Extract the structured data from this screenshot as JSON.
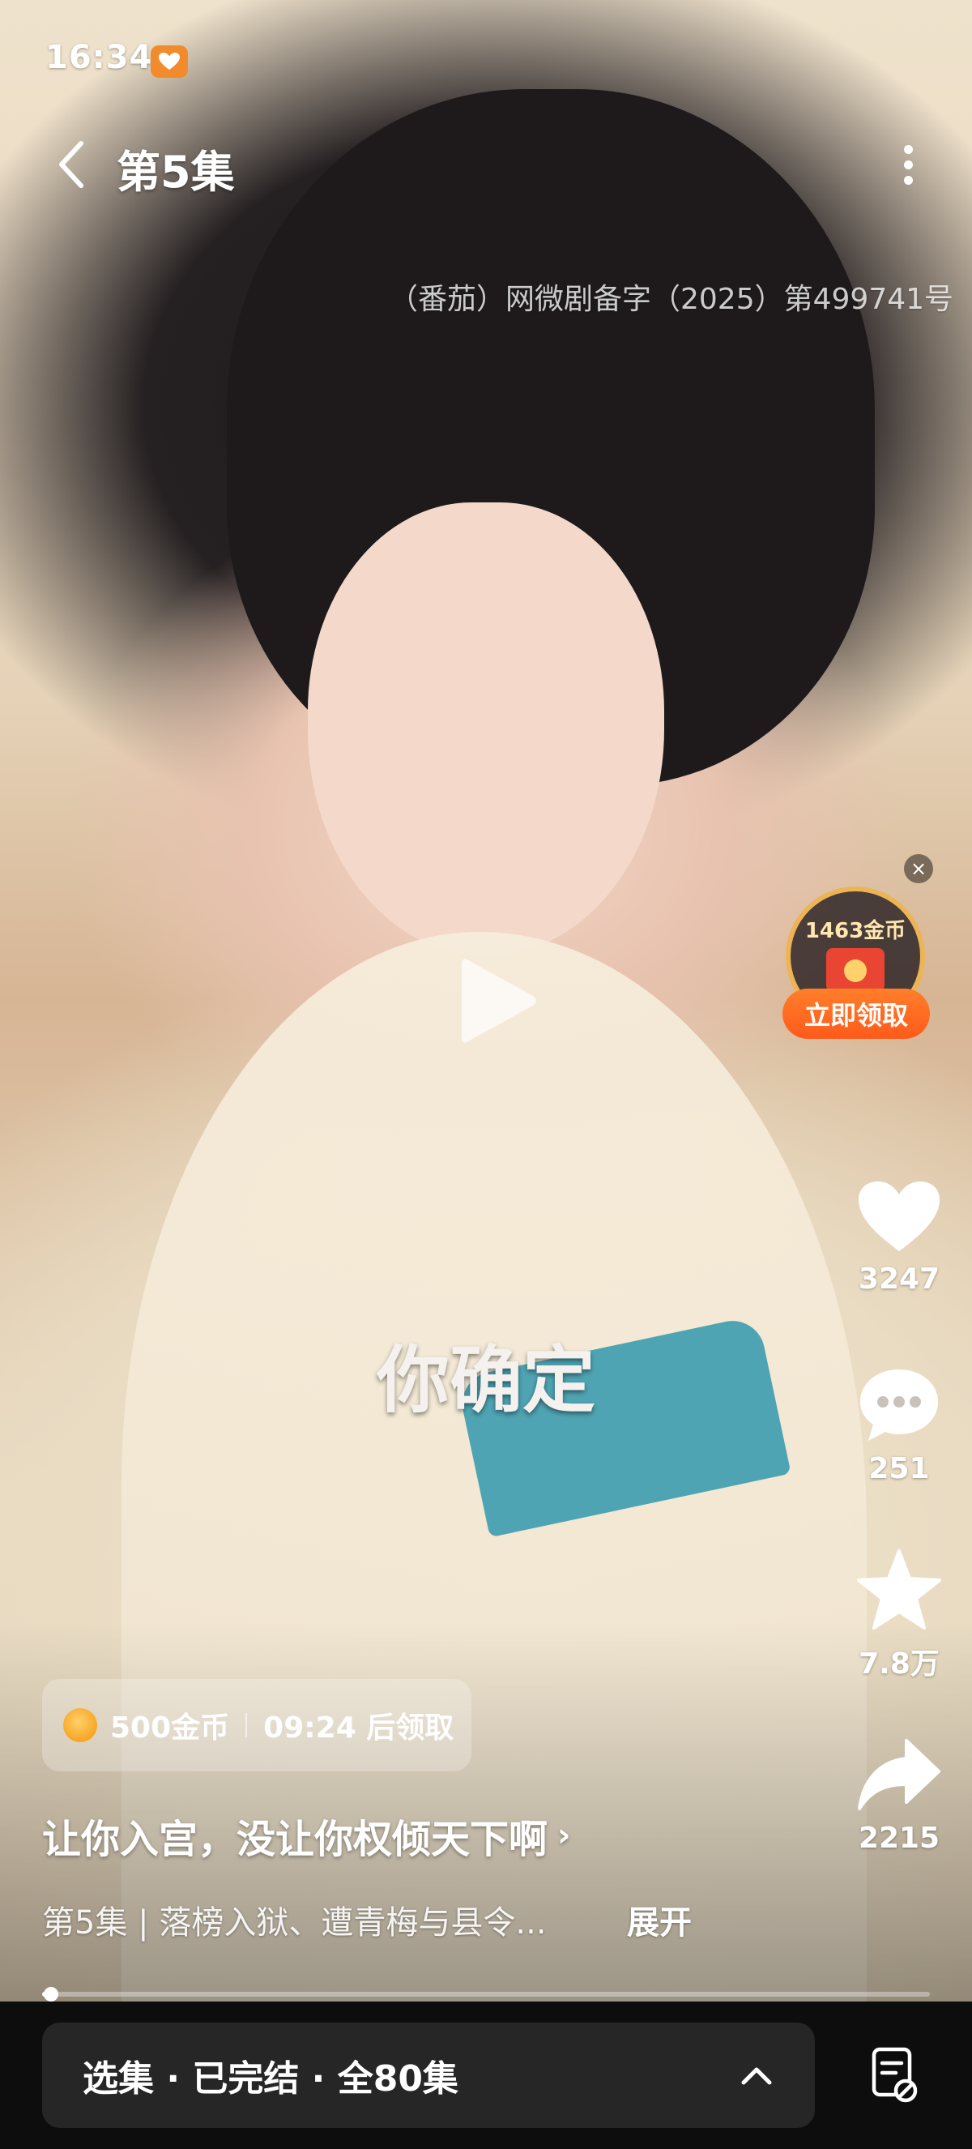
{
  "status_bar": {
    "time": "16:34",
    "icon": "heart-badge-icon"
  },
  "header": {
    "title": "第5集",
    "back_icon": "chevron-left-icon",
    "more_icon": "more-vertical-icon"
  },
  "license_text": "（番茄）网微剧备字（2025）第499741号",
  "subtitle": "你确定",
  "coin_widget": {
    "amount": "1463金币",
    "claim_label": "立即领取"
  },
  "actions": {
    "like": {
      "count": "3247",
      "icon": "heart-icon"
    },
    "comment": {
      "count": "251",
      "icon": "comment-icon"
    },
    "favorite": {
      "count": "7.8万",
      "icon": "star-icon"
    },
    "share": {
      "count": "2215",
      "icon": "share-icon"
    }
  },
  "coin_timer": {
    "coins": "500金币",
    "countdown": "09:24 后领取"
  },
  "drama_title": "让你入宫，没让你权倾天下啊",
  "episode_description": "第5集 | 落榜入狱、遭青梅与县令...",
  "expand_label": "展开",
  "progress": {
    "fraction": 0.01
  },
  "bottom_bar": {
    "selector_text": "选集 · 已完结 · 全80集"
  },
  "colors": {
    "accent_orange": "#ff6a1f",
    "coin_gold": "#f7a524",
    "bottom_bar": "#0d0d0d"
  }
}
